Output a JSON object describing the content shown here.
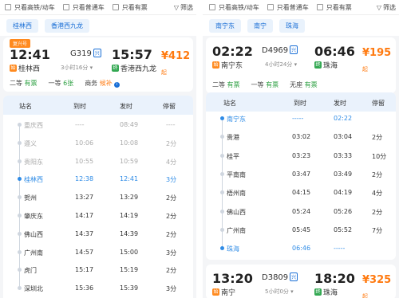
{
  "filters": {
    "hsr_only": "只看高铁/动车",
    "normal_only": "只看普通车",
    "tickets_only": "只看有票",
    "filter_btn": "筛选"
  },
  "left": {
    "chips": [
      "桂林西",
      "香港西九龙"
    ],
    "card": {
      "badge": "复兴号",
      "depart_time": "12:41",
      "train_no": "G319",
      "fuxing": "兴",
      "arrive_time": "15:57",
      "price_symbol": "¥",
      "price": "412",
      "price_suffix": "起",
      "start_tag": "始",
      "end_tag": "终",
      "from": "桂林西",
      "duration": "3小时16分",
      "to": "香港西九龙",
      "seats": [
        {
          "name": "二等",
          "status": "有票"
        },
        {
          "name": "一等",
          "status": "6张"
        },
        {
          "name": "商务",
          "status": "候补"
        }
      ]
    },
    "table": {
      "headers": [
        "站名",
        "到时",
        "发时",
        "停留"
      ],
      "rows": [
        {
          "station": "重庆西",
          "arrive": "----",
          "depart": "08:49",
          "stay": "----",
          "state": "grey"
        },
        {
          "station": "遵义",
          "arrive": "10:06",
          "depart": "10:08",
          "stay": "2分",
          "state": "grey"
        },
        {
          "station": "贵阳东",
          "arrive": "10:55",
          "depart": "10:59",
          "stay": "4分",
          "state": "grey"
        },
        {
          "station": "桂林西",
          "arrive": "12:38",
          "depart": "12:41",
          "stay": "3分",
          "state": "blue"
        },
        {
          "station": "贺州",
          "arrive": "13:27",
          "depart": "13:29",
          "stay": "2分",
          "state": "normal"
        },
        {
          "station": "肇庆东",
          "arrive": "14:17",
          "depart": "14:19",
          "stay": "2分",
          "state": "normal"
        },
        {
          "station": "佛山西",
          "arrive": "14:37",
          "depart": "14:39",
          "stay": "2分",
          "state": "normal"
        },
        {
          "station": "广州南",
          "arrive": "14:57",
          "depart": "15:00",
          "stay": "3分",
          "state": "normal"
        },
        {
          "station": "虎门",
          "arrive": "15:17",
          "depart": "15:19",
          "stay": "2分",
          "state": "normal"
        },
        {
          "station": "深圳北",
          "arrive": "15:36",
          "depart": "15:39",
          "stay": "3分",
          "state": "normal"
        }
      ]
    }
  },
  "right": {
    "chips": [
      "南宁东",
      "南宁",
      "珠海"
    ],
    "card": {
      "depart_time": "02:22",
      "train_no": "D4969",
      "fuxing": "兴",
      "arrive_time": "06:46",
      "price_symbol": "¥",
      "price": "195",
      "price_suffix": "起",
      "start_tag": "始",
      "end_tag": "终",
      "from": "南宁东",
      "duration": "4小时24分",
      "to": "珠海",
      "seats": [
        {
          "name": "二等",
          "status": "有票"
        },
        {
          "name": "一等",
          "status": "有票"
        },
        {
          "name": "无座",
          "status": "有票"
        }
      ]
    },
    "table": {
      "headers": [
        "站名",
        "到时",
        "发时",
        "停留"
      ],
      "rows": [
        {
          "station": "南宁东",
          "arrive": "-----",
          "depart": "02:22",
          "stay": "",
          "state": "blue"
        },
        {
          "station": "贵港",
          "arrive": "03:02",
          "depart": "03:04",
          "stay": "2分",
          "state": "normal"
        },
        {
          "station": "桂平",
          "arrive": "03:23",
          "depart": "03:33",
          "stay": "10分",
          "state": "normal"
        },
        {
          "station": "平南南",
          "arrive": "03:47",
          "depart": "03:49",
          "stay": "2分",
          "state": "normal"
        },
        {
          "station": "梧州南",
          "arrive": "04:15",
          "depart": "04:19",
          "stay": "4分",
          "state": "normal"
        },
        {
          "station": "佛山西",
          "arrive": "05:24",
          "depart": "05:26",
          "stay": "2分",
          "state": "normal"
        },
        {
          "station": "广州南",
          "arrive": "05:45",
          "depart": "05:52",
          "stay": "7分",
          "state": "normal"
        },
        {
          "station": "珠海",
          "arrive": "06:46",
          "depart": "-----",
          "stay": "",
          "state": "blue"
        }
      ]
    },
    "card2": {
      "depart_time": "13:20",
      "train_no": "D3809",
      "fuxing": "兴",
      "arrive_time": "18:20",
      "price_symbol": "¥",
      "price": "325",
      "price_suffix": "起",
      "start_tag": "始",
      "end_tag": "终",
      "from": "南宁",
      "duration": "5小时0分",
      "to": "珠海"
    }
  }
}
